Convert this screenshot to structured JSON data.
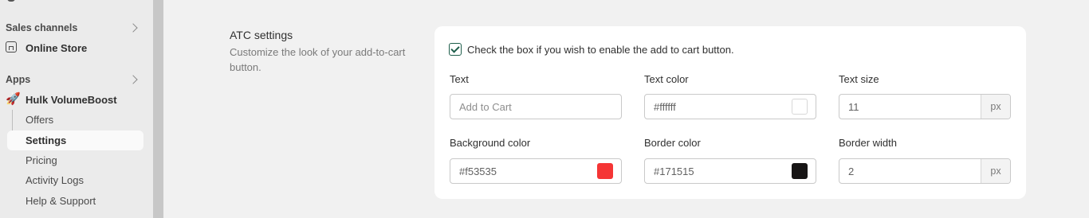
{
  "sidebar": {
    "sales_channels_label": "Sales channels",
    "online_store_label": "Online Store",
    "apps_label": "Apps",
    "app_name": "Hulk VolumeBoost",
    "sub_items": [
      "Offers",
      "Settings",
      "Pricing",
      "Activity Logs",
      "Help & Support"
    ],
    "active_item": "Settings"
  },
  "section": {
    "title": "ATC settings",
    "description": "Customize the look of your add-to-cart button."
  },
  "card": {
    "enable_checkbox_label": "Check the box if you wish to enable the add to cart button.",
    "enable_checked": true,
    "text_label": "Text",
    "text_placeholder": "Add to Cart",
    "text_color_label": "Text color",
    "text_color_value": "#ffffff",
    "text_size_label": "Text size",
    "text_size_value": "11",
    "text_size_unit": "px",
    "bg_color_label": "Background color",
    "bg_color_value": "#f53535",
    "border_color_label": "Border color",
    "border_color_value": "#171515",
    "border_width_label": "Border width",
    "border_width_value": "2",
    "border_width_unit": "px"
  },
  "colors": {
    "swatch_text": "#ffffff",
    "swatch_background": "#f53535",
    "swatch_border": "#171515",
    "checkbox_accent": "#1e5e4b"
  }
}
